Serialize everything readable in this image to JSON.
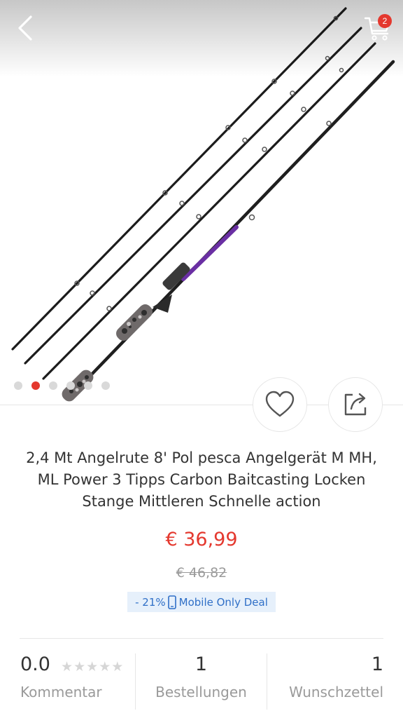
{
  "header": {
    "back_icon": "chevron-left-icon",
    "cart_icon": "cart-icon",
    "cart_count": "2"
  },
  "gallery": {
    "image_count": 6,
    "active_index": 1
  },
  "actions": {
    "wishlist_icon": "heart-outline-icon",
    "share_icon": "share-icon"
  },
  "product": {
    "title": "2,4 Mt Angelrute 8' Pol pesca Angelgerät M MH, ML Power 3 Tipps Carbon Baitcasting Locken Stange Mittleren Schnelle action",
    "price": "€ 36,99",
    "old_price": "€ 46,82",
    "discount": "- 21%",
    "deal_label": "Mobile Only Deal"
  },
  "stats": {
    "rating_value": "0.0",
    "rating_stars": 0,
    "rating_label": "Kommentar",
    "orders_value": "1",
    "orders_label": "Bestellungen",
    "wishlist_value": "1",
    "wishlist_label": "Wunschzettel"
  },
  "colors": {
    "accent_red": "#e4382e",
    "deal_blue": "#2f6fc7",
    "rod_purple": "#6a2fa3"
  }
}
